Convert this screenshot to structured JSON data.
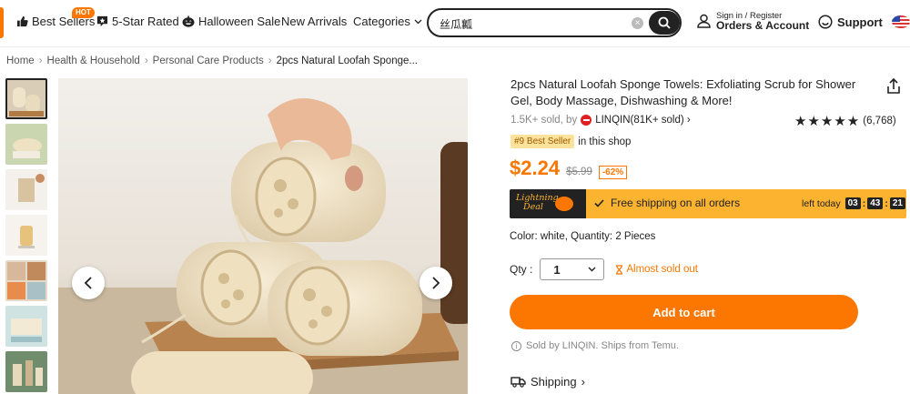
{
  "header": {
    "nav": [
      {
        "label": "Best Sellers",
        "icon": "thumbs-up-icon"
      },
      {
        "label": "5-Star Rated",
        "icon": "star-badge-icon"
      },
      {
        "label": "Halloween Sale",
        "icon": "pumpkin-icon"
      },
      {
        "label": "New Arrivals"
      },
      {
        "label": "Categories",
        "icon": "chevron-down-icon"
      }
    ],
    "hot_badge": "HOT",
    "search": {
      "value": "丝瓜瓤",
      "placeholder": ""
    },
    "account": {
      "small": "Sign in / Register",
      "big": "Orders & Account"
    },
    "support": "Support"
  },
  "breadcrumb": [
    "Home",
    "Health & Household",
    "Personal Care Products",
    "2pcs Natural Loofah Sponge..."
  ],
  "product": {
    "title": "2pcs Natural Loofah Sponge Towels: Exfoliating Scrub for Shower Gel, Body Massage, Dishwashing & More!",
    "sold": "1.5K+ sold, by",
    "store": "LINQIN(81K+ sold)",
    "stars": "★★★★★",
    "rating_value": 4.5,
    "reviews": "(6,768)",
    "best_badge": "#9 Best Seller",
    "best_text": "in this shop",
    "price": "$2.24",
    "original_price": "$5.99",
    "discount": "-62%",
    "deal": {
      "logo_line1": "Lightning",
      "logo_line2": "Deal",
      "shipping": "Free shipping on all orders",
      "left_today": "left today",
      "timer": [
        "03",
        "43",
        "21"
      ]
    },
    "variant": "Color: white, Quantity: 2 Pieces",
    "qty_label": "Qty :",
    "qty_value": "1",
    "almost_sold": "Almost sold out",
    "add_to_cart": "Add to cart",
    "sold_by": "Sold by LINQIN. Ships from Temu.",
    "shipping": "Shipping"
  },
  "colors": {
    "accent": "#fb7701",
    "deal_bar": "#fbb330",
    "dark": "#222222"
  }
}
